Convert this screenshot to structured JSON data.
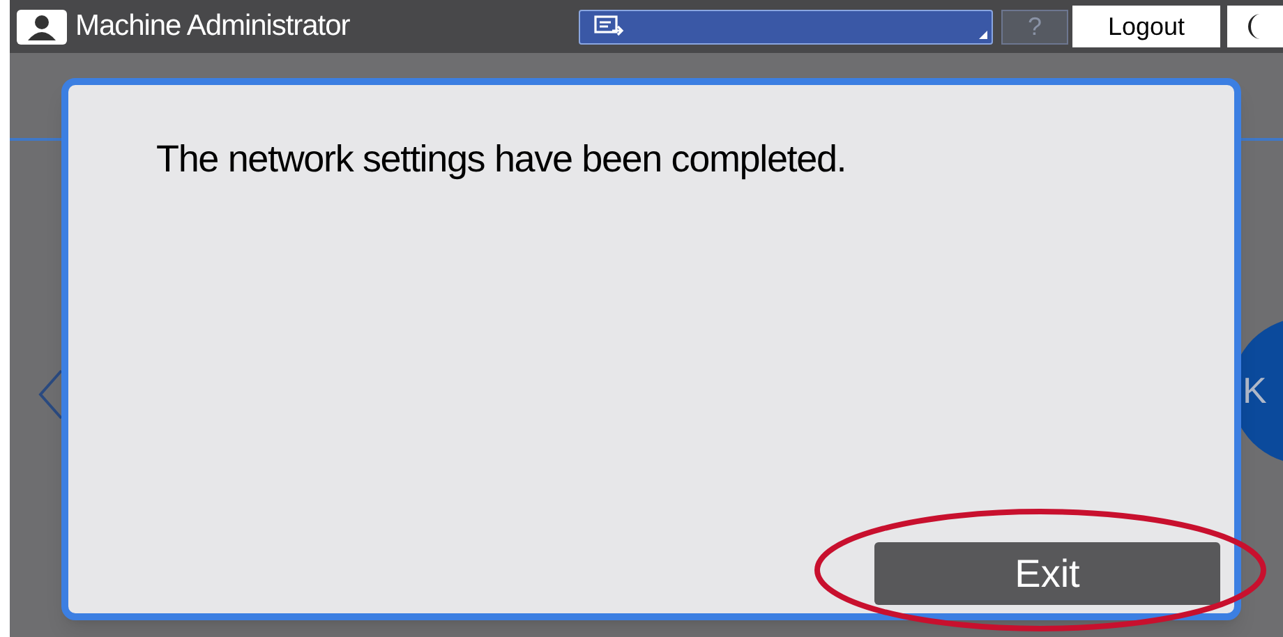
{
  "header": {
    "user": "Machine Administrator",
    "help": "?",
    "logout": "Logout"
  },
  "background": {
    "ok_button": "K"
  },
  "dialog": {
    "message": "The network settings have been completed.",
    "exit": "Exit"
  }
}
